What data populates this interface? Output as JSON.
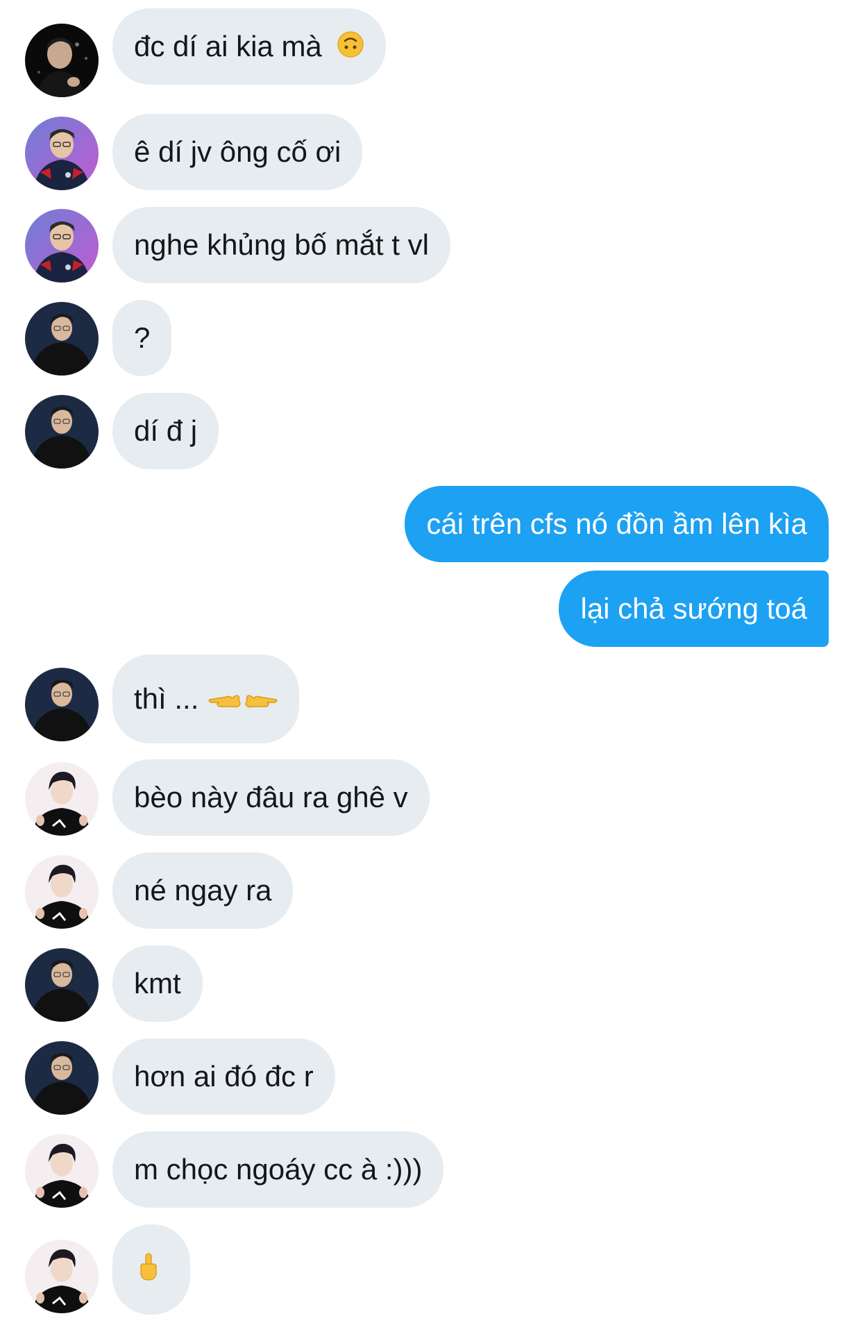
{
  "messages": [
    {
      "side": "in",
      "avatar": "user-a",
      "text": "đc dí ai kia mà",
      "emoji": "upside-down-face-icon"
    },
    {
      "side": "in",
      "avatar": "user-b",
      "text": "ê dí jv ông cố ơi"
    },
    {
      "side": "in",
      "avatar": "user-b",
      "text": "nghe khủng bố mắt t vl"
    },
    {
      "side": "in",
      "avatar": "user-c",
      "text": "?"
    },
    {
      "side": "in",
      "avatar": "user-c",
      "text": "dí đ j"
    },
    {
      "side": "out",
      "text": "cái trên cfs nó đồn ầm lên kìa"
    },
    {
      "side": "out",
      "text": "lại chả sướng toá"
    },
    {
      "side": "in",
      "avatar": "user-c",
      "text": "thì ...",
      "emoji": "pointing-fingers-icon"
    },
    {
      "side": "in",
      "avatar": "user-d",
      "text": "bèo này đâu ra ghê v"
    },
    {
      "side": "in",
      "avatar": "user-d",
      "text": "né ngay ra"
    },
    {
      "side": "in",
      "avatar": "user-c",
      "text": "kmt"
    },
    {
      "side": "in",
      "avatar": "user-c",
      "text": "hơn ai đó đc r"
    },
    {
      "side": "in",
      "avatar": "user-d",
      "text": "m chọc ngoáy cc à :)))"
    },
    {
      "side": "in",
      "avatar": "user-d",
      "text": "",
      "emoji": "middle-finger-icon"
    }
  ],
  "colors": {
    "incoming_bubble": "#e6ecf0",
    "outgoing_bubble": "#1da1f2",
    "incoming_text": "#14171a",
    "outgoing_text": "#ffffff"
  }
}
